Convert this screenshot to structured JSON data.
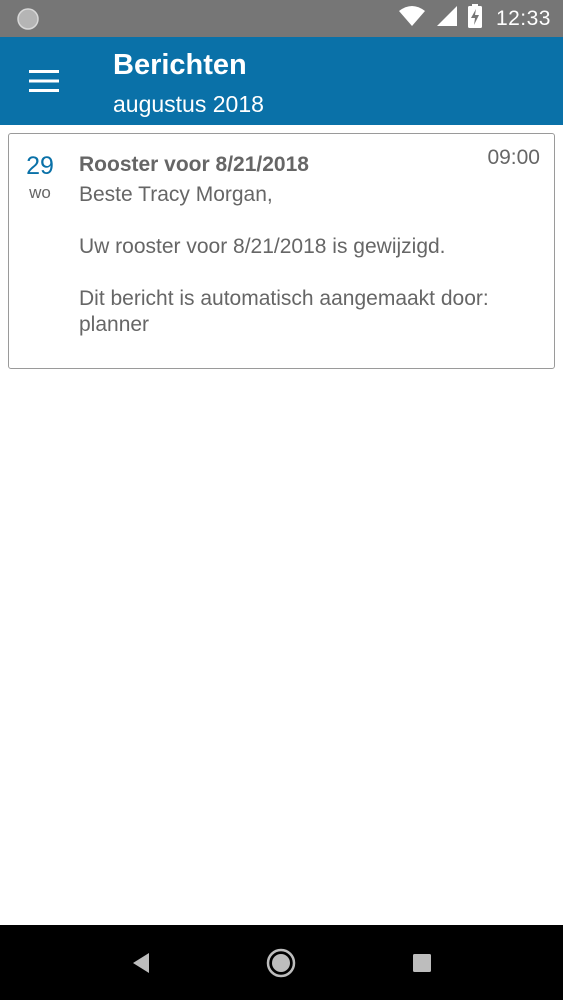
{
  "status_bar": {
    "time": "12:33",
    "icons": [
      "notification-dot-icon",
      "wifi-icon",
      "signal-icon",
      "battery-charging-icon"
    ]
  },
  "app_bar": {
    "menu_icon": "hamburger-menu-icon",
    "title": "Berichten",
    "subtitle": "augustus 2018",
    "color": "#0a71a8"
  },
  "messages": [
    {
      "day": "29",
      "weekday": "wo",
      "time": "09:00",
      "subject": "Rooster voor 8/21/2018",
      "body": {
        "greeting": "Beste Tracy Morgan,",
        "line1": "Uw rooster voor 8/21/2018 is gewijzigd.",
        "line2": "Dit bericht is automatisch aangemaakt door:",
        "line3": "planner"
      }
    }
  ],
  "nav_bar": {
    "icons": [
      "back-icon",
      "home-icon",
      "recents-icon"
    ]
  }
}
